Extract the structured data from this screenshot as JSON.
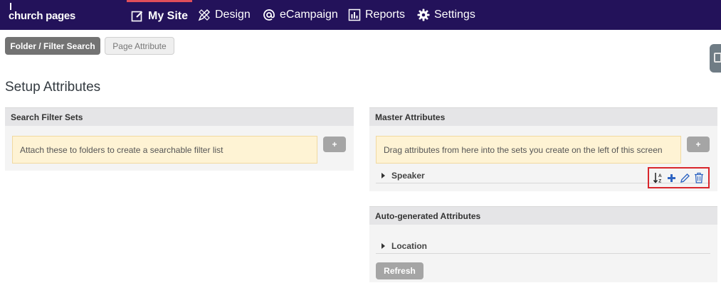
{
  "app": {
    "logo_text": "church pages"
  },
  "nav": {
    "items": [
      {
        "label": "My Site",
        "icon": "edit-square-icon",
        "active": true
      },
      {
        "label": "Design",
        "icon": "pencil-ruler-icon"
      },
      {
        "label": "eCampaign",
        "icon": "at-sign-icon"
      },
      {
        "label": "Reports",
        "icon": "bar-chart-icon"
      },
      {
        "label": "Settings",
        "icon": "gear-icon"
      }
    ],
    "active_color": "#e04e5a",
    "bar_color": "#23125a"
  },
  "tabs": [
    {
      "label": "Folder / Filter Search",
      "active": true
    },
    {
      "label": "Page Attribute",
      "active": false
    }
  ],
  "page": {
    "title": "Setup Attributes"
  },
  "search_filter_sets": {
    "header": "Search Filter Sets",
    "notice": "Attach these to folders to create a searchable filter list",
    "add_label": "+"
  },
  "master_attributes": {
    "header": "Master Attributes",
    "notice": "Drag attributes from here into the sets you create on the left of this screen",
    "add_label": "+",
    "items": [
      {
        "label": "Speaker"
      }
    ],
    "action_icons": [
      "sort-az-icon",
      "plus-icon",
      "pencil-icon",
      "trash-icon"
    ],
    "highlight_color": "#d9262c"
  },
  "auto_attributes": {
    "header": "Auto-generated Attributes",
    "items": [
      {
        "label": "Location"
      }
    ],
    "refresh_label": "Refresh"
  }
}
